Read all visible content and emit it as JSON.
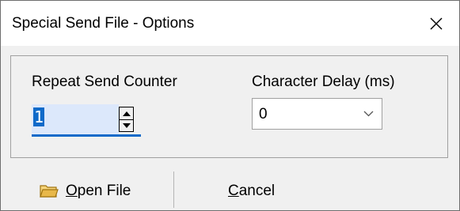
{
  "window": {
    "title": "Special Send File - Options",
    "close_glyph": "✕"
  },
  "options": {
    "repeat_label": "Repeat Send Counter",
    "repeat_value": "1",
    "delay_label": "Character Delay (ms)",
    "delay_value": "0"
  },
  "buttons": {
    "open_file_mnemonic": "O",
    "open_file_rest": "pen File",
    "cancel_mnemonic": "C",
    "cancel_rest": "ancel"
  },
  "icons": {
    "close": "close-icon",
    "spin_up": "triangle-up-icon",
    "spin_down": "triangle-down-icon",
    "dropdown": "chevron-down-icon",
    "open_file": "folder-icon"
  },
  "colors": {
    "selection": "#0f6ac9",
    "input_background": "#dce8fb",
    "dialog_background": "#f0f0f0",
    "folder": "#e8b84a"
  }
}
